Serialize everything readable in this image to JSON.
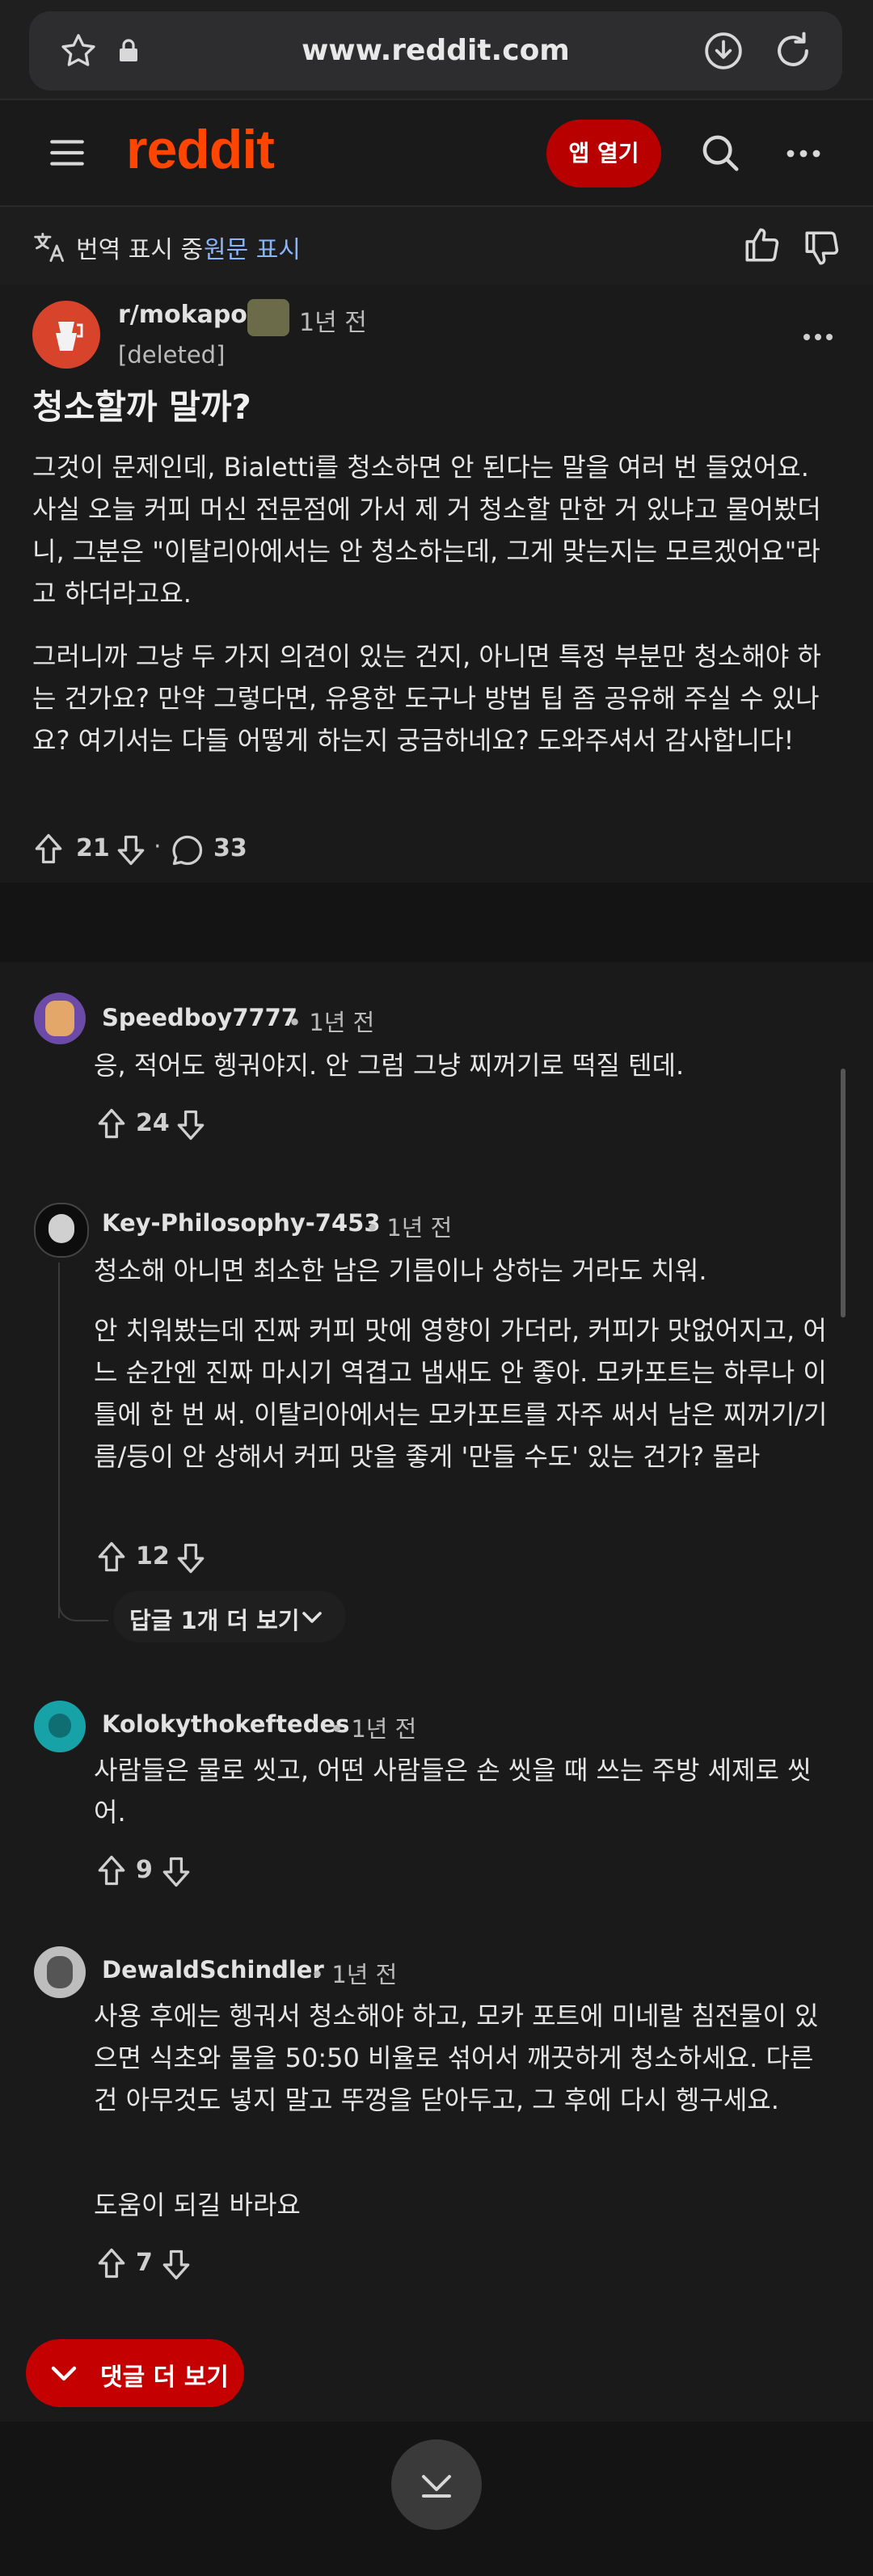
{
  "browser": {
    "url": "www.reddit.com"
  },
  "nav": {
    "logo": "reddit",
    "open_app": "앱 열기"
  },
  "translation": {
    "showing": "번역 표시 중",
    "show_original": "원문 표시"
  },
  "post": {
    "subreddit": "r/mokapot",
    "time": "1년 전",
    "author": "[deleted]",
    "title": "청소할까 말까?",
    "body": [
      "그것이 문제인데, Bialetti를 청소하면 안 된다는 말을 여러 번 들었어요. 사실 오늘 커피 머신 전문점에 가서 제 거 청소할 만한 거 있냐고 물어봤더니, 그분은 \"이탈리아에서는 안 청소하는데, 그게 맞는지는 모르겠어요\"라고 하더라고요.",
      "그러니까 그냥 두 가지 의견이 있는 건지, 아니면 특정 부분만 청소해야 하는 건가요? 만약 그렇다면, 유용한 도구나 방법 팁 좀 공유해 주실 수 있나요? 여기서는 다들 어떻게 하는지 궁금하네요? 도와주셔서 감사합니다!"
    ],
    "votes": "21",
    "separator": "·",
    "comments": "33"
  },
  "comments": [
    {
      "user": "Speedboy7777",
      "time": "• 1년 전",
      "body": [
        "응, 적어도 헹궈야지. 안 그럼 그냥 찌꺼기로 떡질 텐데."
      ],
      "votes": "24"
    },
    {
      "user": "Key-Philosophy-7453",
      "time": "• 1년 전",
      "body": [
        "청소해 아니면 최소한 남은 기름이나 상하는 거라도 치워.",
        "안 치워봤는데 진짜 커피 맛에 영향이 가더라, 커피가 맛없어지고, 어느 순간엔 진짜 마시기 역겹고 냄새도 안 좋아. 모카포트는 하루나 이틀에 한 번 써. 이탈리아에서는 모카포트를 자주 써서 남은 찌꺼기/기름/등이 안 상해서 커피 맛을 좋게 '만들 수도' 있는 건가? 몰라"
      ],
      "votes": "12",
      "more_replies": "답글 1개 더 보기"
    },
    {
      "user": "Kolokythokeftedes",
      "time": "• 1년 전",
      "body": [
        "사람들은 물로 씻고, 어떤 사람들은 손 씻을 때 쓰는 주방 세제로 씻어."
      ],
      "votes": "9"
    },
    {
      "user": "DewaldSchindler",
      "time": "• 1년 전",
      "body": [
        "사용 후에는 헹궈서 청소해야 하고, 모카 포트에 미네랄 침전물이 있으면 식초와 물을 50:50 비율로 섞어서 깨끗하게 청소하세요. 다른 건 아무것도 넣지 말고 뚜껑을 닫아두고, 그 후에 다시 헹구세요.",
        "도움이 되길 바라요"
      ],
      "votes": "7"
    }
  ],
  "more_comments": "댓글 더 보기",
  "icons": {
    "star": "star-icon",
    "lock": "lock-icon",
    "download": "download-icon",
    "reload": "reload-icon",
    "menu": "menu-icon",
    "search": "search-icon",
    "more": "more-icon",
    "translate": "translate-icon",
    "thumbs_up": "thumbs-up-icon",
    "thumbs_down": "thumbs-down-icon",
    "upvote": "upvote-icon",
    "downvote": "downvote-icon",
    "comment": "comment-icon",
    "chevron_down": "chevron-down-icon"
  },
  "colors": {
    "brand": "#ff4500",
    "button_red": "#c40000",
    "link": "#8ab4f8"
  }
}
